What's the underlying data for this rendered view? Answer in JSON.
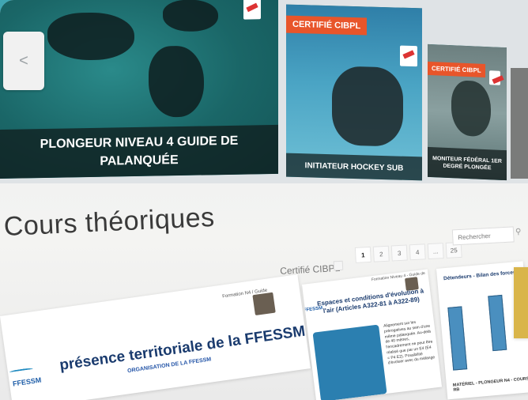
{
  "carousel": {
    "prev_icon": "<",
    "cards": [
      {
        "caption": "PLONGEUR NIVEAU 4 GUIDE DE PALANQUÉE",
        "badge": ""
      },
      {
        "caption": "INITIATEUR HOCKEY SUB",
        "badge": "CERTIFIÉ CIBPL"
      },
      {
        "caption": "MONITEUR FÉDÉRAL 1er DEGRÉ PLONGÉE",
        "badge": "CERTIFIÉ CIBPL"
      }
    ]
  },
  "section": {
    "title": "Cours théoriques"
  },
  "filters": {
    "certified_label": "Certifié CIBPL",
    "pages": [
      "1",
      "2",
      "3",
      "4",
      "...",
      "25"
    ],
    "active_page": "1",
    "search_placeholder": "Rechercher",
    "search_icon": "search-icon"
  },
  "documents": [
    {
      "tag": "Formation N4 / Guide",
      "title": "présence territoriale de la FFESSM",
      "subtitle": "ORGANISATION DE LA FFESSM",
      "logo": "FFESSM"
    },
    {
      "tag": "Formation Niveau 4 - Guide de",
      "title": "Espaces et conditions d'évolution à l'air (Articles A322-81 à A322-89)",
      "logo": "FFESSM",
      "bullets": "Alignement sur les prérogatives au sein d'une même palanquée. Au-delà de 40 mètres, l'encadrement ne peut être réalisé que par un E4 (E4 = P4 E2). Possibilité d'évoluer avec du mélange"
    },
    {
      "tag": "",
      "title": "Détendeurs - Bilan des forces",
      "caption": "MATÉRIEL - PLONGEUR N4 - COURS RB"
    }
  ],
  "colors": {
    "badge": "#e8552a",
    "title_text": "#3a3a3a",
    "doc_title": "#1a3b6e"
  }
}
